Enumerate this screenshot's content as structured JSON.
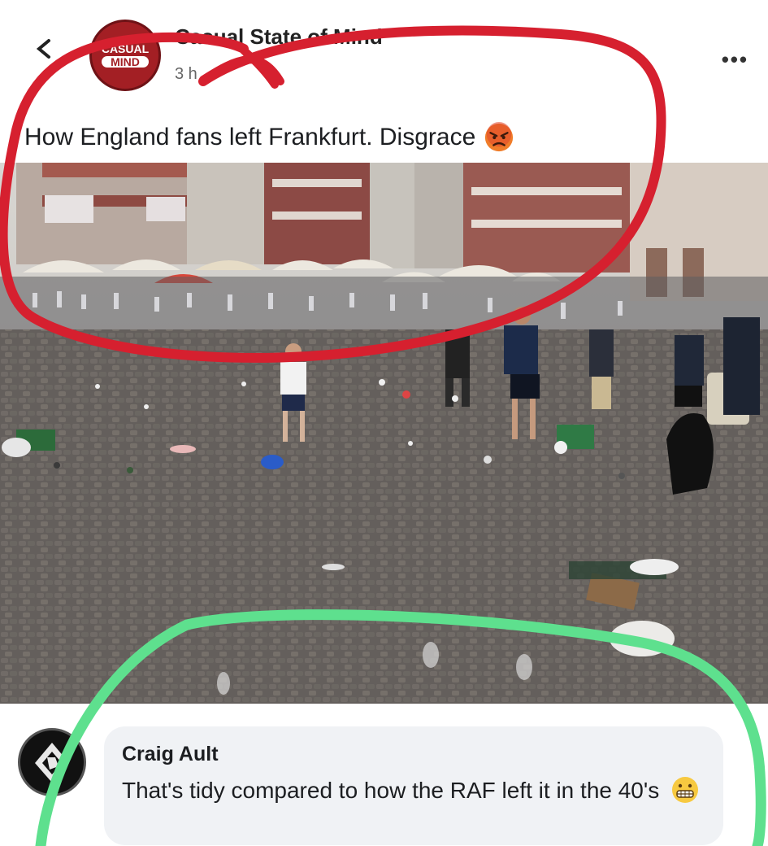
{
  "post": {
    "page_name": "Casual State of Mind",
    "avatar_text_line1": "CASUAL",
    "avatar_text_line2": "MIND",
    "timestamp": "3 h",
    "caption": "How England fans left Frankfurt. Disgrace",
    "caption_emoji": "angry-face-icon",
    "more_label": "•••"
  },
  "comment": {
    "author": "Craig Ault",
    "text": "That's tidy compared to how the RAF left it in the 40's",
    "emoji": "grimacing-face-icon"
  },
  "annotations": {
    "red_circle_color": "#d6202f",
    "green_circle_color": "#5ee08e"
  },
  "colors": {
    "brand_red": "#a31f24",
    "bubble": "#f0f2f5",
    "text": "#1c1e21"
  }
}
